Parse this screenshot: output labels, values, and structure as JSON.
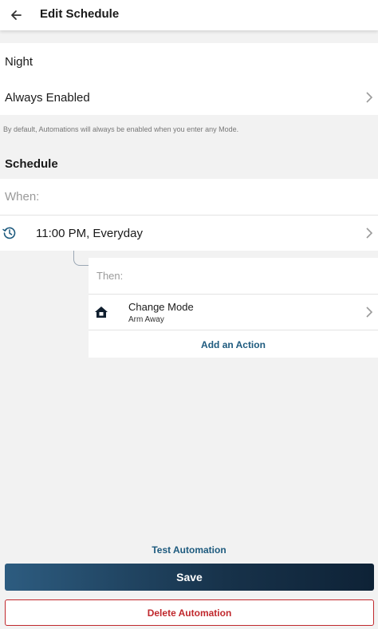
{
  "header": {
    "title": "Edit Schedule",
    "back_icon": "arrow-left-icon"
  },
  "automation": {
    "name": "Night",
    "mode_setting": "Always Enabled",
    "help_text": "By default, Automations will always be enabled when you enter any Mode."
  },
  "schedule": {
    "section_title": "Schedule",
    "when_label": "When:",
    "trigger": {
      "icon": "clock-history-icon",
      "text": "11:00 PM, Everyday"
    }
  },
  "actions": {
    "then_label": "Then:",
    "items": [
      {
        "icon": "home-mode-icon",
        "title": "Change Mode",
        "subtitle": "Arm Away"
      }
    ],
    "add_label": "Add an Action"
  },
  "footer": {
    "test_label": "Test Automation",
    "save_label": "Save",
    "delete_label": "Delete Automation"
  },
  "colors": {
    "accent_link": "#1d5a7e",
    "save_gradient_start": "#2d5c80",
    "save_gradient_end": "#0e2236",
    "danger": "#c0282d",
    "background": "#f2f2f2"
  }
}
